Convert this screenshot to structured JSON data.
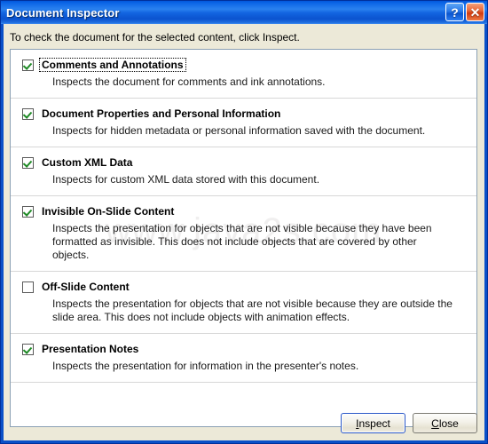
{
  "window": {
    "title": "Document Inspector",
    "help_button": "?",
    "close_button": "✕"
  },
  "instruction": "To check the document for the selected content, click Inspect.",
  "watermark": "www.java2s.com",
  "items": [
    {
      "title": "Comments and Annotations",
      "description": "Inspects the document for comments and ink annotations.",
      "checked": true,
      "focused": true
    },
    {
      "title": "Document Properties and Personal Information",
      "description": "Inspects for hidden metadata or personal information saved with the document.",
      "checked": true,
      "focused": false
    },
    {
      "title": "Custom XML Data",
      "description": "Inspects for custom XML data stored with this document.",
      "checked": true,
      "focused": false
    },
    {
      "title": "Invisible On-Slide Content",
      "description": "Inspects the presentation for objects that are not visible because they have been formatted as invisible. This does not include objects that are covered by other objects.",
      "checked": true,
      "focused": false
    },
    {
      "title": "Off-Slide Content",
      "description": "Inspects the presentation for objects that are not visible because they are outside the slide area. This does not include objects with animation effects.",
      "checked": false,
      "focused": false
    },
    {
      "title": "Presentation Notes",
      "description": "Inspects the presentation for information in the presenter's notes.",
      "checked": true,
      "focused": false
    }
  ],
  "footer": {
    "inspect_label": "Inspect",
    "inspect_accel": "I",
    "inspect_rest": "nspect",
    "close_label": "Close",
    "close_accel": "C",
    "close_rest": "lose"
  },
  "colors": {
    "title_bar_blue": "#0a64e6",
    "frame_blue": "#0a50c8",
    "dialog_face": "#ece9d8",
    "list_bg": "#ffffff",
    "check_green": "#1f8a26",
    "close_red": "#d03a10",
    "watermark_gray": "#f0efef",
    "separator": "#d7d7d7"
  }
}
